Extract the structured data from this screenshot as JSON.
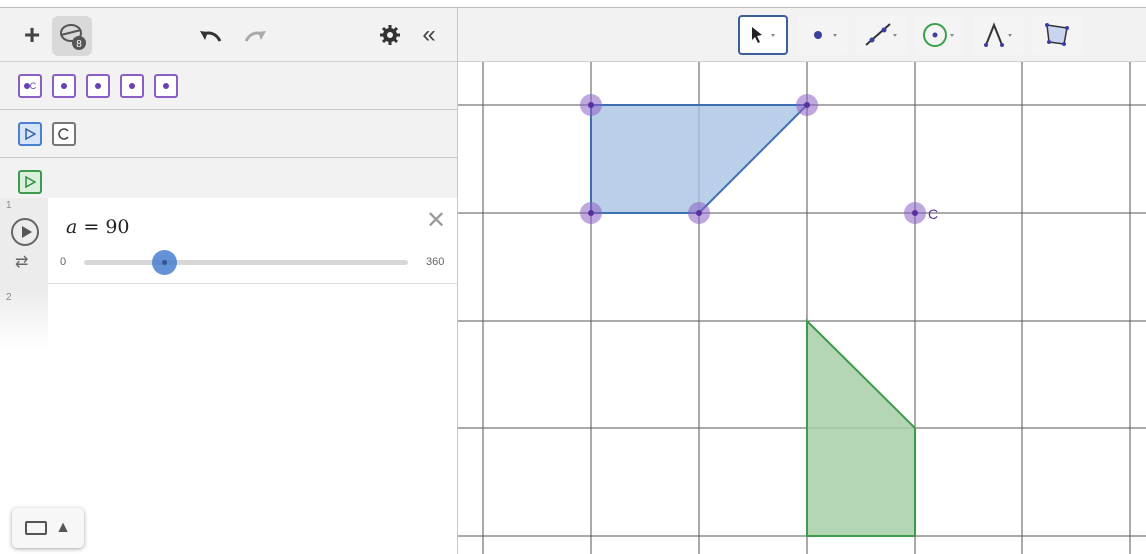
{
  "header": {
    "plus_label": "+",
    "algebra_badge": "8",
    "undo_label": "↶",
    "redo_label": "↷",
    "settings_label": "⚙",
    "collapse_label": "«"
  },
  "tool_rows": [
    {
      "tools": [
        "point-on-object",
        "point",
        "point",
        "point",
        "point"
      ],
      "first_label": "C"
    },
    {
      "tools": [
        "move",
        "rotate"
      ]
    },
    {
      "tools": [
        "move-graphics"
      ]
    }
  ],
  "algebra": {
    "rows": [
      {
        "number": "1",
        "lhs": "a",
        "rhs": "90",
        "slider": {
          "min": "0",
          "max": "360",
          "value": 90
        }
      },
      {
        "number": "2"
      }
    ],
    "close_label": "✕"
  },
  "keyboard": {
    "arrow": "▲"
  },
  "graphics_tools": [
    {
      "name": "move-tool",
      "selected": true
    },
    {
      "name": "point-tool",
      "selected": false
    },
    {
      "name": "line-tool",
      "selected": false
    },
    {
      "name": "circle-tool",
      "selected": false
    },
    {
      "name": "angle-tool",
      "selected": false
    },
    {
      "name": "polygon-tool",
      "selected": false
    }
  ],
  "point_label": "C",
  "colors": {
    "accent": "#4b7fd1",
    "point": "#8b5ec5",
    "blue_poly": "#a9c4e4",
    "green_poly": "#a7cfa8"
  }
}
